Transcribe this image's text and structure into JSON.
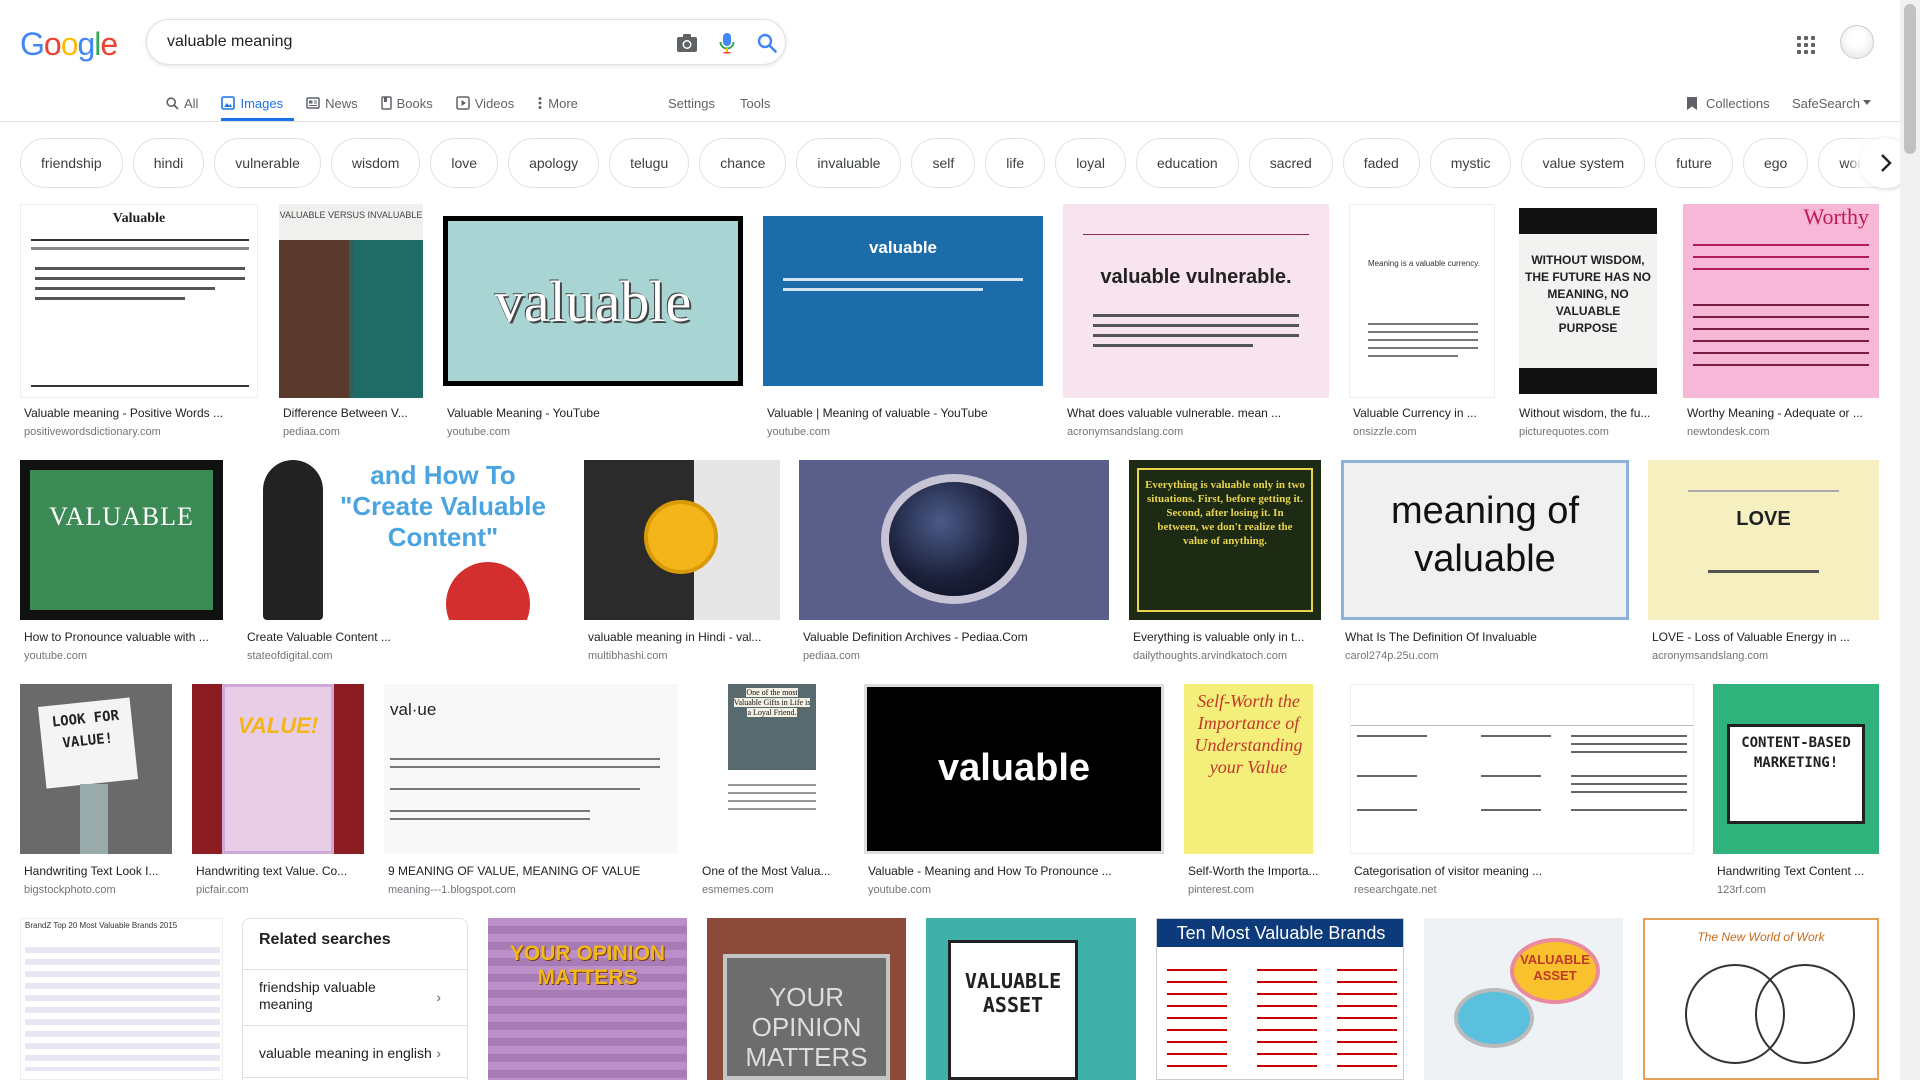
{
  "search": {
    "query": "valuable meaning"
  },
  "logo": {
    "letters": [
      "G",
      "o",
      "o",
      "g",
      "l",
      "e"
    ]
  },
  "tabs": [
    {
      "label": "All",
      "icon": "search-icon"
    },
    {
      "label": "Images",
      "icon": "image-icon"
    },
    {
      "label": "News",
      "icon": "news-icon"
    },
    {
      "label": "Books",
      "icon": "book-icon"
    },
    {
      "label": "Videos",
      "icon": "video-icon"
    },
    {
      "label": "More",
      "icon": "more-vert-icon"
    }
  ],
  "tools": {
    "settings": "Settings",
    "tools": "Tools",
    "collections": "Collections",
    "safesearch": "SafeSearch"
  },
  "chips": [
    "friendship",
    "hindi",
    "vulnerable",
    "wisdom",
    "love",
    "apology",
    "telugu",
    "chance",
    "invaluable",
    "self",
    "life",
    "loyal",
    "education",
    "sacred",
    "faded",
    "mystic",
    "value system",
    "future",
    "ego",
    "worthy"
  ],
  "results": [
    {
      "caption": "Valuable meaning - Positive Words ...",
      "source": "positivewordsdictionary.com",
      "text": "Valuable"
    },
    {
      "caption": "Difference Between V...",
      "source": "pediaa.com",
      "text": "VALUABLE VERSUS INVALUABLE"
    },
    {
      "caption": "Valuable Meaning - YouTube",
      "source": "youtube.com",
      "text": "valuable"
    },
    {
      "caption": "Valuable | Meaning of valuable - YouTube",
      "source": "youtube.com",
      "text": "valuable"
    },
    {
      "caption": "What does valuable vulnerable. mean ...",
      "source": "acronymsandslang.com",
      "text": "valuable vulnerable."
    },
    {
      "caption": "Valuable Currency in ...",
      "source": "onsizzle.com",
      "text": "Meaning is a valuable currency."
    },
    {
      "caption": "Without wisdom, the fu...",
      "source": "picturequotes.com",
      "text": "WITHOUT WISDOM, THE FUTURE HAS NO MEANING, NO VALUABLE PURPOSE"
    },
    {
      "caption": "Worthy Meaning - Adequate or ...",
      "source": "newtondesk.com",
      "text": "Worthy"
    },
    {
      "caption": "How to Pronounce valuable with ...",
      "source": "youtube.com",
      "text": "VALUABLE"
    },
    {
      "caption": "Create Valuable Content ...",
      "source": "stateofdigital.com",
      "text": "and How To \"Create Valuable Content\""
    },
    {
      "caption": "valuable meaning in Hindi - val...",
      "source": "multibhashi.com",
      "text": ""
    },
    {
      "caption": "Valuable Definition Archives - Pediaa.Com",
      "source": "pediaa.com",
      "text": ""
    },
    {
      "caption": "Everything is valuable only in t...",
      "source": "dailythoughts.arvindkatoch.com",
      "text": "Everything is valuable only in two situations. First, before getting it. Second, after losing it. In between, we don't realize the value of anything."
    },
    {
      "caption": "What Is The Definition Of Invaluable",
      "source": "carol274p.25u.com",
      "text": "meaning of valuable"
    },
    {
      "caption": "LOVE - Loss of Valuable Energy in ...",
      "source": "acronymsandslang.com",
      "text": "LOVE"
    },
    {
      "caption": "Handwriting Text Look I...",
      "source": "bigstockphoto.com",
      "text": "LOOK FOR VALUE!"
    },
    {
      "caption": "Handwriting text Value. Co...",
      "source": "picfair.com",
      "text": "VALUE!"
    },
    {
      "caption": "9 MEANING OF VALUE, MEANING OF VALUE",
      "source": "meaning---1.blogspot.com",
      "text": "val·ue"
    },
    {
      "caption": "One of the Most Valua...",
      "source": "esmemes.com",
      "text": "One of the most Valuable Gifts in Life is a Loyal Friend."
    },
    {
      "caption": "Valuable - Meaning and How To Pronounce ...",
      "source": "youtube.com",
      "text": "valuable"
    },
    {
      "caption": "Self-Worth the Importa...",
      "source": "pinterest.com",
      "text": "Self-Worth the Importance of Understanding your Value"
    },
    {
      "caption": "Categorisation of visitor meaning ...",
      "source": "researchgate.net",
      "text": ""
    },
    {
      "caption": "Handwriting Text Content ...",
      "source": "123rf.com",
      "text": "CONTENT-BASED MARKETING!"
    },
    {
      "caption": "",
      "source": "",
      "text": "BrandZ Top 20 Most Valuable Brands 2015"
    },
    {
      "caption": "",
      "source": "",
      "text": "YOUR OPINION MATTERS"
    },
    {
      "caption": "",
      "source": "",
      "text": "YOUR OPINION MATTERS"
    },
    {
      "caption": "",
      "source": "",
      "text": "VALUABLE ASSET"
    },
    {
      "caption": "",
      "source": "",
      "text": "Ten Most Valuable Brands"
    },
    {
      "caption": "",
      "source": "",
      "text": "VALUABLE ASSET"
    },
    {
      "caption": "",
      "source": "",
      "text": "The New World of Work"
    }
  ],
  "related": {
    "title": "Related searches",
    "items": [
      "friendship valuable meaning",
      "valuable meaning in english"
    ]
  },
  "colors": {
    "accent": "#1a73e8",
    "text": "#202124",
    "muted": "#70757a",
    "border": "#dfe1e5"
  }
}
